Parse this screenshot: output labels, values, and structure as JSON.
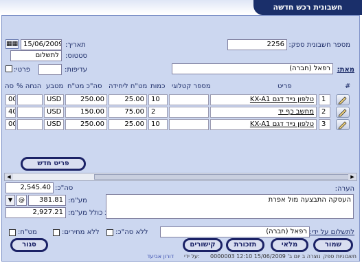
{
  "title": "חשבונית רכש חדשה",
  "header": {
    "supplier_invoice_label": "מספר חשבונית ספק:",
    "supplier_invoice_value": "2256",
    "date_label": "תאריך:",
    "date_value": "15/06/2009",
    "status_label": "סטטוס:",
    "status_value": "לתשלום",
    "priority_label": "עדיפות:",
    "priority_value": "",
    "details_label": "פרטי:",
    "from_label": "מאת:",
    "from_value": "רפאל (חברה)"
  },
  "grid": {
    "columns": [
      "#",
      "פריט",
      "מספר קטלוגי",
      "כמות",
      "מט\"ח ליחידה",
      "סה\"כ מט\"ח",
      "מטבע",
      "% הנחה",
      "סה"
    ],
    "rows": [
      {
        "num": "1",
        "item": "טלפון נייד דגם KX-A1",
        "catalog": "",
        "qty": "10",
        "unit": "25.00",
        "total": "250.00",
        "currency": "USD",
        "discount": "",
        "sum": "00"
      },
      {
        "num": "2",
        "item": "מחשב כף יד",
        "catalog": "",
        "qty": "2",
        "unit": "75.00",
        "total": "150.00",
        "currency": "USD",
        "discount": "",
        "sum": "40"
      },
      {
        "num": "3",
        "item": "טלפון נייד דגם KX-A1",
        "catalog": "",
        "qty": "10",
        "unit": "25.00",
        "total": "250.00",
        "currency": "USD",
        "discount": "",
        "sum": "00"
      }
    ],
    "new_item_button": "פריט חדש"
  },
  "totals": {
    "total_label": "סה\"כ:",
    "total_value": "2,545.40",
    "vat_label": "מע\"מ:",
    "vat_value": "381.81",
    "vat_dropdown": "▼",
    "grand_label": "סה\"כ כולל מע\"מ:",
    "grand_value": "2,927.21"
  },
  "notes": {
    "label": "הערה:",
    "value": "העסקה התבצעה מול אפרת"
  },
  "payment": {
    "pay_by_label": "לתשלום על ידי:",
    "pay_by_value": "רפאל (חברה)"
  },
  "options": {
    "no_total": "ללא סה\"כ:",
    "no_prices": "ללא מחירים:",
    "forex": "מט\"ח:"
  },
  "buttons": {
    "save": "שמור",
    "full": "מלאי",
    "reports": "תזכורת",
    "links": "קישורים",
    "close": "סגור"
  },
  "status_bar": {
    "left": "חשבוניות ספק",
    "created": "0000003 נוצרה ב יום ב' 15/06/2009 12:10",
    "by_label": "על ידי:",
    "user": "דורון אביעד"
  }
}
